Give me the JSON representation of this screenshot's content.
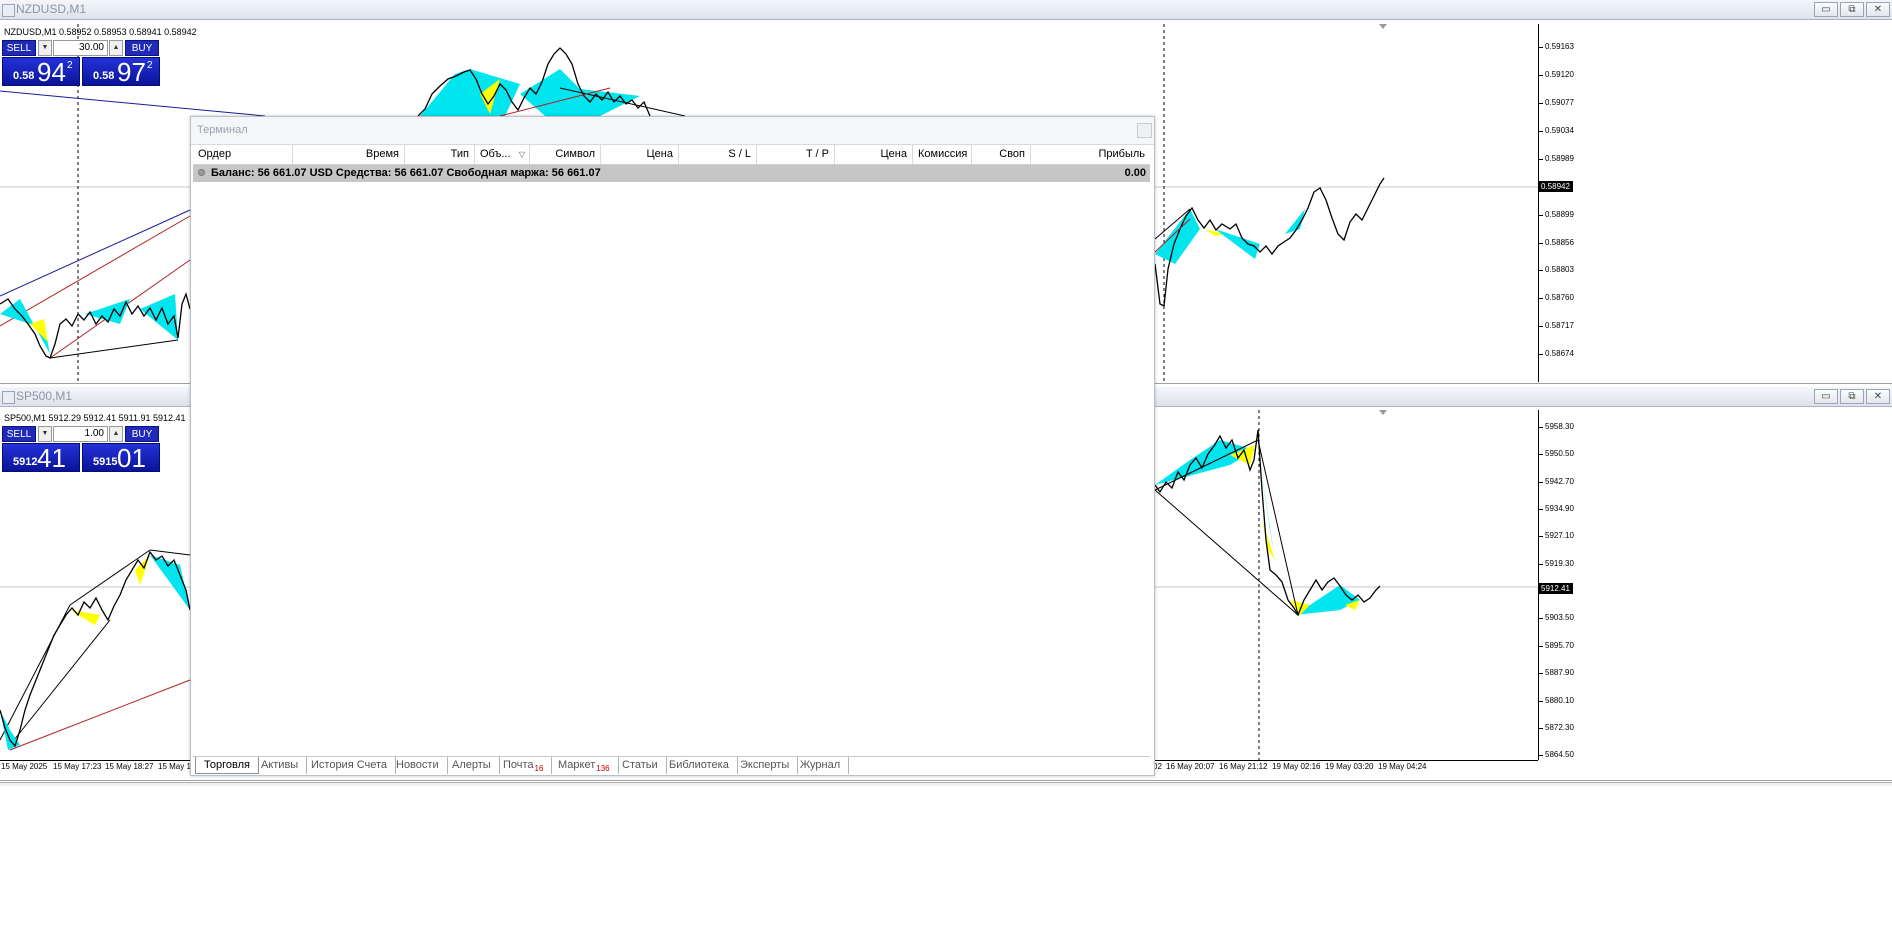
{
  "charts": [
    {
      "title": "NZDUSD,M1",
      "symbol_line": "NZDUSD,M1  0.58952 0.58953 0.58941 0.58942",
      "one_click": {
        "sell_label": "SELL",
        "buy_label": "BUY",
        "volume": "30.00",
        "sell_small": "0.58",
        "sell_big": "94",
        "sell_sup": "2",
        "buy_small": "0.58",
        "buy_big": "97",
        "buy_sup": "2"
      },
      "price_ticks": [
        "0.59163",
        "0.59120",
        "0.59077",
        "0.59034",
        "0.58989",
        "0.58899",
        "0.58856",
        "0.58803",
        "0.58760",
        "0.58717",
        "0.58674"
      ],
      "current_price_label": "0.58942"
    },
    {
      "title": "SP500,M1",
      "symbol_line": "SP500,M1  5912.29 5912.41 5911.91 5912.41",
      "one_click": {
        "sell_label": "SELL",
        "buy_label": "BUY",
        "volume": "1.00",
        "sell_small": "5912",
        "sell_big": "41",
        "sell_sup": "",
        "buy_small": "5915",
        "buy_big": "01",
        "buy_sup": ""
      },
      "price_ticks": [
        "5958.30",
        "5950.50",
        "5942.70",
        "5934.90",
        "5927.10",
        "5919.30",
        "5903.50",
        "5895.70",
        "5887.90",
        "5880.10",
        "5872.30",
        "5864.50"
      ],
      "current_price_label": "5912.41",
      "time_labels_left": [
        "15 May 2025",
        "15 May 17:23",
        "15 May 18:27",
        "15 May 1"
      ],
      "time_labels_right": [
        "02",
        "16 May 20:07",
        "16 May 21:12",
        "19 May 02:16",
        "19 May 03:20",
        "19 May 04:24"
      ]
    }
  ],
  "window_buttons": {
    "minimize": "▭",
    "restore": "⧉",
    "close": "✕"
  },
  "terminal": {
    "title": "Терминал",
    "columns": [
      "Ордер",
      "Время",
      "Тип",
      "Объ...",
      "Символ",
      "Цена",
      "S / L",
      "T / P",
      "Цена",
      "Комиссия",
      "Своп",
      "Прибыль"
    ],
    "balance_text": "Баланс: 56 661.07 USD  Средства: 56 661.07  Свободная маржа: 56 661.07",
    "balance_profit": "0.00",
    "tabs": [
      {
        "label": "Торговля",
        "badge": ""
      },
      {
        "label": "Активы",
        "badge": ""
      },
      {
        "label": "История Счета",
        "badge": ""
      },
      {
        "label": "Новости",
        "badge": ""
      },
      {
        "label": "Алерты",
        "badge": ""
      },
      {
        "label": "Почта",
        "badge": "16"
      },
      {
        "label": "Маркет",
        "badge": "136"
      },
      {
        "label": "Статьи",
        "badge": ""
      },
      {
        "label": "Библиотека",
        "badge": ""
      },
      {
        "label": "Эксперты",
        "badge": ""
      },
      {
        "label": "Журнал",
        "badge": ""
      }
    ]
  }
}
